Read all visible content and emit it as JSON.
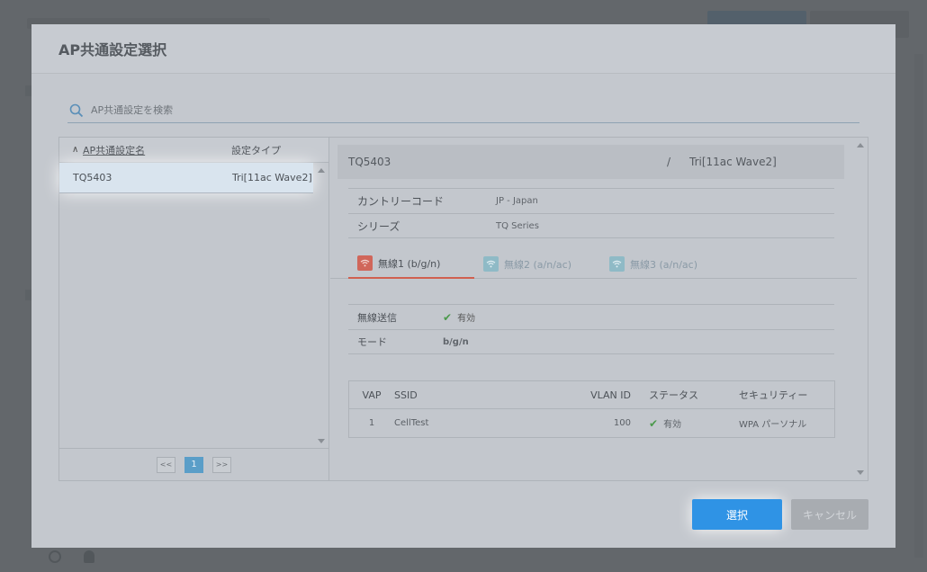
{
  "modal": {
    "title": "AP共通設定選択",
    "search_placeholder": "AP共通設定を検索"
  },
  "list": {
    "headers": {
      "name": "AP共通設定名",
      "type": "設定タイプ"
    },
    "rows": [
      {
        "name": "TQ5403",
        "type": "Tri[11ac Wave2]"
      }
    ],
    "pager": {
      "prev": "<<",
      "page": "1",
      "next": ">>"
    }
  },
  "detail": {
    "id": "TQ5403",
    "separator": "/",
    "type": "Tri[11ac Wave2]",
    "info": [
      {
        "label": "カントリーコード",
        "value": "JP - Japan"
      },
      {
        "label": "シリーズ",
        "value": "TQ Series"
      }
    ],
    "tabs": [
      {
        "label": "無線1 (b/g/n)",
        "active": true
      },
      {
        "label": "無線2 (a/n/ac)",
        "active": false
      },
      {
        "label": "無線3 (a/n/ac)",
        "active": false
      }
    ],
    "radio": {
      "tx_label": "無線送信",
      "tx_value": "有効",
      "mode_label": "モード",
      "mode_value": "b/g/n"
    },
    "vap": {
      "headers": {
        "vap": "VAP",
        "ssid": "SSID",
        "vlan": "VLAN ID",
        "status": "ステータス",
        "security": "セキュリティー"
      },
      "rows": [
        {
          "vap": "1",
          "ssid": "CellTest",
          "vlan": "100",
          "status": "有効",
          "security": "WPA パーソナル"
        }
      ]
    }
  },
  "buttons": {
    "select": "選択",
    "cancel": "キャンセル"
  },
  "colors": {
    "primary": "#2f93e5",
    "tab_active": "#d0665a",
    "tab_inactive": "#8fbac6",
    "check": "#4c9a4c"
  }
}
